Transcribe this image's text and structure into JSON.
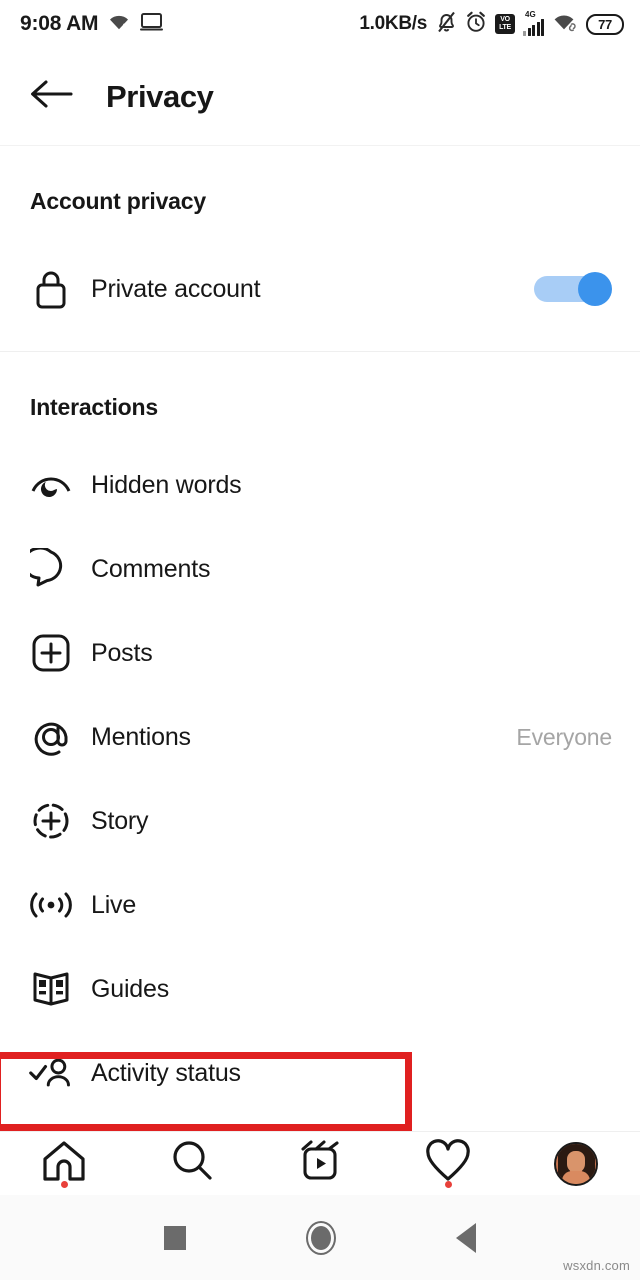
{
  "status_bar": {
    "time": "9:08 AM",
    "wifi_icon": "wifi-icon",
    "cast_icon": "cast-screen-icon",
    "data_speed": "1.0KB/s",
    "silent_icon": "bell-muted-icon",
    "alarm_icon": "alarm-clock-icon",
    "volte_line1": "VO",
    "volte_line2": "LTE",
    "network_type": "4G",
    "signal_icon": "signal-bars-icon",
    "wifi_right_icon": "wifi-icon",
    "battery_percent": "77"
  },
  "header": {
    "back_icon": "back-arrow-icon",
    "title": "Privacy"
  },
  "sections": [
    {
      "title": "Account privacy",
      "rows": [
        {
          "icon": "lock-icon",
          "label": "Private account",
          "control": "toggle",
          "toggle_on": true
        }
      ]
    },
    {
      "title": "Interactions",
      "rows": [
        {
          "icon": "eye-icon",
          "label": "Hidden words",
          "value": ""
        },
        {
          "icon": "comment-icon",
          "label": "Comments",
          "value": ""
        },
        {
          "icon": "post-plus-icon",
          "label": "Posts",
          "value": ""
        },
        {
          "icon": "at-mention-icon",
          "label": "Mentions",
          "value": "Everyone"
        },
        {
          "icon": "story-plus-icon",
          "label": "Story",
          "value": ""
        },
        {
          "icon": "live-icon",
          "label": "Live",
          "value": ""
        },
        {
          "icon": "guides-icon",
          "label": "Guides",
          "value": ""
        },
        {
          "icon": "activity-status-icon",
          "label": "Activity status",
          "value": ""
        }
      ]
    }
  ],
  "highlight": {
    "target_label": "Activity status",
    "color": "#e02020"
  },
  "bottom_nav": {
    "items": [
      {
        "icon": "home-icon",
        "badge": true
      },
      {
        "icon": "search-icon",
        "badge": false
      },
      {
        "icon": "reels-icon",
        "badge": false
      },
      {
        "icon": "heart-icon",
        "badge": true
      },
      {
        "icon": "profile-avatar-icon",
        "badge": false
      }
    ]
  },
  "system_nav": {
    "recents_icon": "recents-square-icon",
    "home_icon": "home-circle-icon",
    "back_icon": "back-triangle-icon"
  },
  "watermark": {
    "text": "wsxdn.com"
  },
  "colors": {
    "accent_blue": "#3b93ec",
    "track_blue": "#a8cdf6",
    "highlight_red": "#e02020",
    "badge_red": "#e8403a",
    "text_primary": "#171717",
    "text_muted": "#a5a5a5"
  }
}
